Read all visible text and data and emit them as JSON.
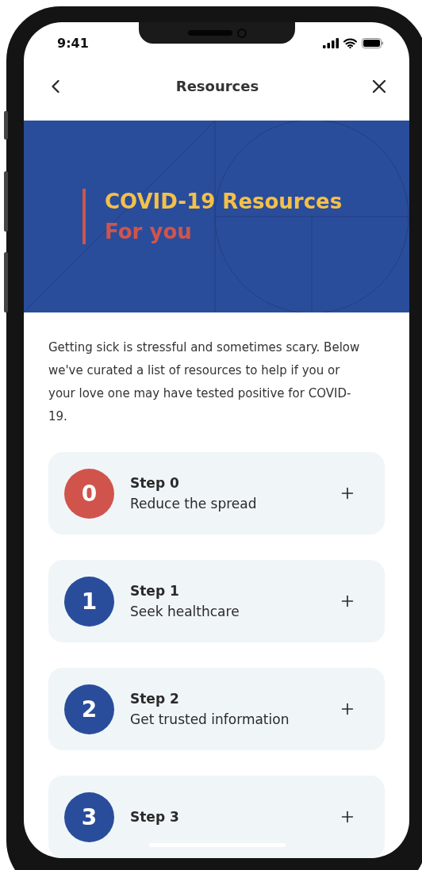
{
  "status_bar": {
    "time": "9:41"
  },
  "nav": {
    "title": "Resources"
  },
  "banner": {
    "title": "COVID-19 Resources",
    "subtitle": "For you"
  },
  "intro": "Getting sick is stressful and sometimes scary. Below we've curated a list of resources to help if you or your love one may have tested positive for COVID-19.",
  "steps": [
    {
      "number": "0",
      "title": "Step 0",
      "subtitle": "Reduce the spread",
      "color": "#d0544c"
    },
    {
      "number": "1",
      "title": "Step 1",
      "subtitle": "Seek healthcare",
      "color": "#2a4d9b"
    },
    {
      "number": "2",
      "title": "Step 2",
      "subtitle": "Get trusted information",
      "color": "#2a4d9b"
    },
    {
      "number": "3",
      "title": "Step 3",
      "color": "#2a4d9b"
    }
  ]
}
